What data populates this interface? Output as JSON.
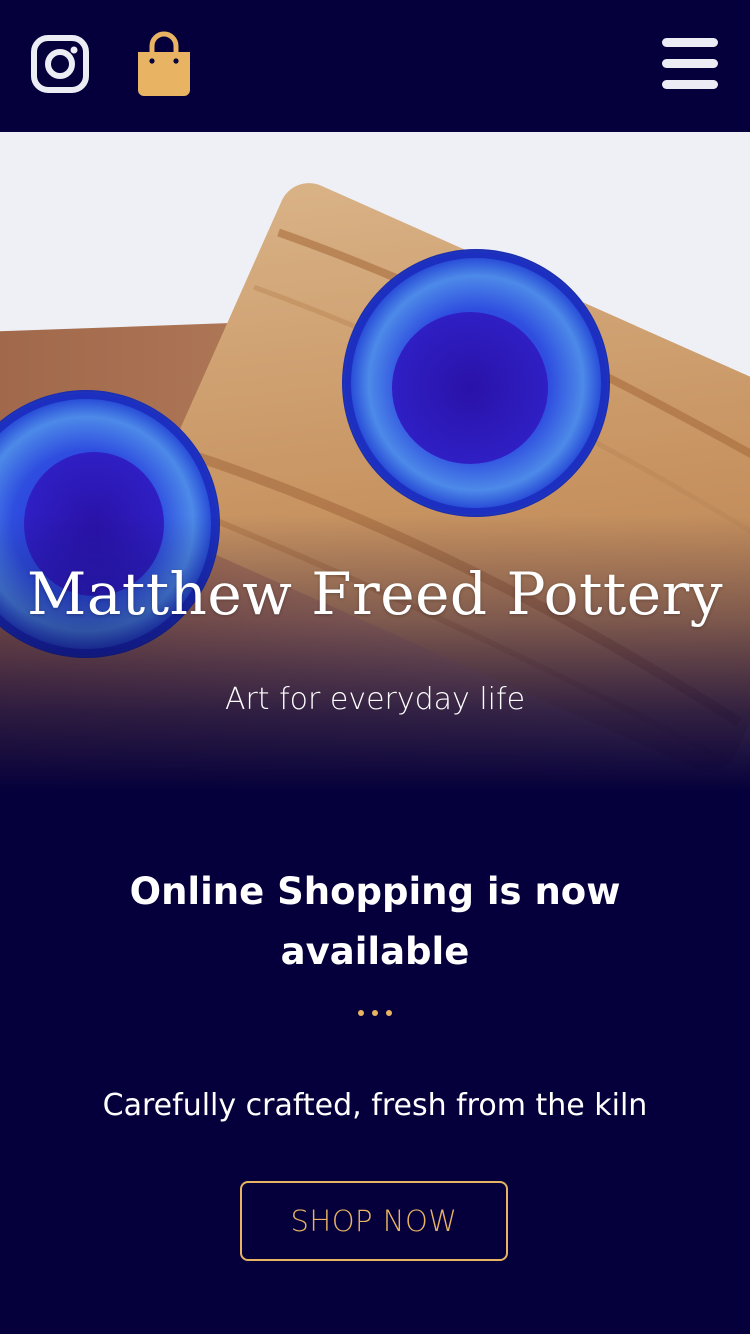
{
  "header": {
    "instagram_icon": "instagram-icon",
    "bag_icon": "shopping-bag-icon",
    "menu_icon": "hamburger-menu-icon"
  },
  "hero": {
    "title": "Matthew Freed Pottery",
    "subtitle": "Art for everyday life"
  },
  "main": {
    "headline": "Online Shopping is now available",
    "tagline": "Carefully crafted, fresh from the kiln",
    "shop_button_label": "SHOP NOW"
  },
  "colors": {
    "background": "#05003b",
    "accent": "#e8b463",
    "text": "#ffffff"
  }
}
